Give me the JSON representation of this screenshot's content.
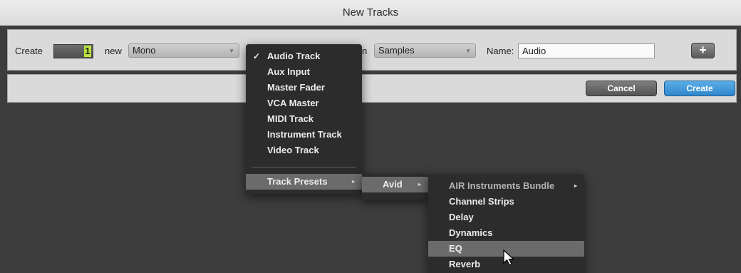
{
  "window": {
    "title": "New Tracks"
  },
  "row1": {
    "create_label": "Create",
    "count": "1",
    "new_label": "new",
    "format_value": "Mono",
    "in_label": "n",
    "timebase_value": "Samples",
    "name_label": "Name:",
    "name_value": "Audio",
    "add_label": "+"
  },
  "row2": {
    "cancel_label": "Cancel",
    "create_label": "Create"
  },
  "track_type_menu": {
    "items": [
      {
        "label": "Audio Track",
        "checked": true
      },
      {
        "label": "Aux Input"
      },
      {
        "label": "Master Fader"
      },
      {
        "label": "VCA Master"
      },
      {
        "label": "MIDI Track"
      },
      {
        "label": "Instrument Track"
      },
      {
        "label": "Video Track"
      }
    ],
    "presets_label": "Track Presets"
  },
  "presets_submenu": {
    "items": [
      {
        "label": "Avid"
      }
    ]
  },
  "avid_submenu": {
    "items": [
      {
        "label": "AIR Instruments Bundle"
      },
      {
        "label": "Channel Strips"
      },
      {
        "label": "Delay"
      },
      {
        "label": "Dynamics"
      },
      {
        "label": "EQ",
        "highlighted": true
      },
      {
        "label": "Reverb"
      }
    ]
  },
  "icons": {
    "check": "checkmark-icon",
    "submenu": "submenu-arrow-icon",
    "cursor": "pointer-cursor-icon"
  }
}
